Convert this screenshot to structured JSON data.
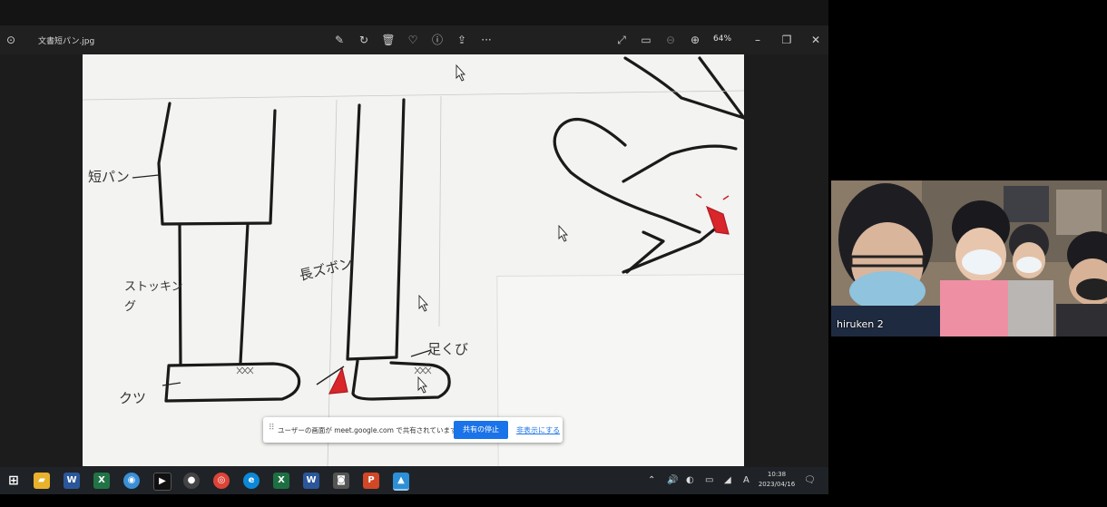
{
  "viewer": {
    "file_name": "文書短パン.jpg",
    "zoom": "64%",
    "toolbar_icons": [
      "edit-icon",
      "rotate-icon",
      "delete-icon",
      "favorite-icon",
      "info-icon",
      "share-icon",
      "more-icon"
    ],
    "right_icons": [
      "fullscreen-icon",
      "slideshow-icon",
      "zoom-out-icon",
      "zoom-in-icon"
    ],
    "window_controls": [
      "minimize-icon",
      "maximize-icon",
      "close-icon"
    ]
  },
  "drawing": {
    "labels": {
      "shorts": "短パン",
      "stocking": "ストッキング",
      "long_pants": "長ズボン",
      "ankle": "足くび",
      "shoe": "クツ"
    },
    "ink_color": "#1a1a1a",
    "accent_red": "#d8262b"
  },
  "share_bar": {
    "grip": "⠿",
    "message": "ユーザーの画面が meet.google.com で共有されています。",
    "stop_label": "共有の停止",
    "hide_label": "非表示にする",
    "accent": "#1a73e8"
  },
  "taskbar": {
    "apps": [
      {
        "name": "start-icon",
        "glyph": "⊞",
        "color": "#1f2327"
      },
      {
        "name": "file-explorer-icon",
        "glyph": "▰",
        "color": "#e8b22c"
      },
      {
        "name": "word-icon",
        "glyph": "W",
        "color": "#2b579a"
      },
      {
        "name": "excel-chart-icon",
        "glyph": "X",
        "color": "#217346"
      },
      {
        "name": "globe-icon",
        "glyph": "◉",
        "color": "#3a8fd6"
      },
      {
        "name": "terminal-icon",
        "glyph": "▶",
        "color": "#111"
      },
      {
        "name": "camera-app-icon",
        "glyph": "●",
        "color": "#444"
      },
      {
        "name": "chrome-icon",
        "glyph": "◎",
        "color": "#db4437"
      },
      {
        "name": "edge-icon",
        "glyph": "e",
        "color": "#0c88d8"
      },
      {
        "name": "excel-icon",
        "glyph": "X",
        "color": "#1d6f42"
      },
      {
        "name": "word-doc-icon",
        "glyph": "W",
        "color": "#2b579a"
      },
      {
        "name": "camera-icon",
        "glyph": "◙",
        "color": "#555"
      },
      {
        "name": "powerpoint-icon",
        "glyph": "P",
        "color": "#d24726"
      },
      {
        "name": "photos-icon",
        "glyph": "▲",
        "color": "#2d8fd6"
      }
    ],
    "tray_icons": [
      "chevron-up-icon",
      "volume-icon",
      "mic-icon",
      "battery-icon",
      "wifi-icon",
      "ime-icon"
    ],
    "ime_label": "A",
    "time": "10:38",
    "date": "2023/04/16"
  },
  "video": {
    "participant_name": "hiruken 2"
  }
}
